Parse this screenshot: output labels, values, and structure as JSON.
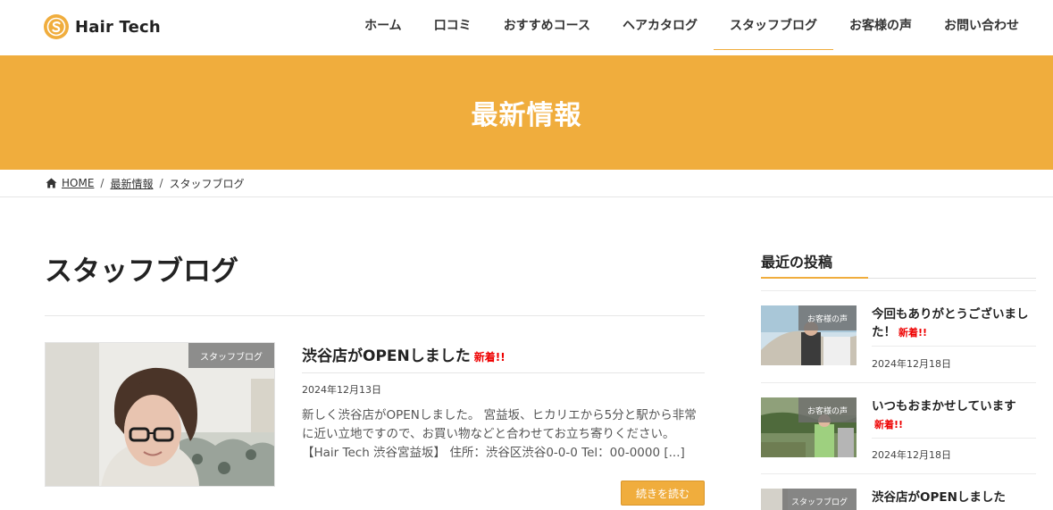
{
  "header": {
    "logo_text": "Hair Tech",
    "nav": [
      {
        "label": "ホーム"
      },
      {
        "label": "口コミ"
      },
      {
        "label": "おすすめコース"
      },
      {
        "label": "ヘアカタログ"
      },
      {
        "label": "スタッフブログ",
        "active": true
      },
      {
        "label": "お客様の声"
      },
      {
        "label": "お問い合わせ"
      }
    ]
  },
  "banner": {
    "title": "最新情報"
  },
  "breadcrumb": {
    "home": "HOME",
    "section": "最新情報",
    "current": "スタッフブログ"
  },
  "main": {
    "page_title": "スタッフブログ",
    "posts": [
      {
        "category": "スタッフブログ",
        "title": "渋谷店がOPENしました",
        "new_label": "新着!!",
        "date": "2024年12月13日",
        "excerpt": "新しく渋谷店がOPENしました。 宮益坂、ヒカリエから5分と駅から非常に近い立地ですので、お買い物などと合わせてお立ち寄りください。【Hair Tech 渋谷宮益坂】 住所：渋谷区渋谷0-0-0 Tel：00-0000 [...]",
        "read_more": "続きを読む"
      }
    ]
  },
  "sidebar": {
    "title": "最近の投稿",
    "posts": [
      {
        "category": "お客様の声",
        "title": "今回もありがとうございました！",
        "new_label": "新着!!",
        "date": "2024年12月18日"
      },
      {
        "category": "お客様の声",
        "title": "いつもおまかせしています",
        "new_label": "新着!!",
        "date": "2024年12月18日"
      },
      {
        "category": "スタッフブログ",
        "title": "渋谷店がOPENしました"
      }
    ]
  },
  "colors": {
    "accent": "#f0ad3d",
    "new": "#ee0000"
  },
  "icons": {
    "logo": "s-circle-logo-icon",
    "home": "home-icon"
  }
}
